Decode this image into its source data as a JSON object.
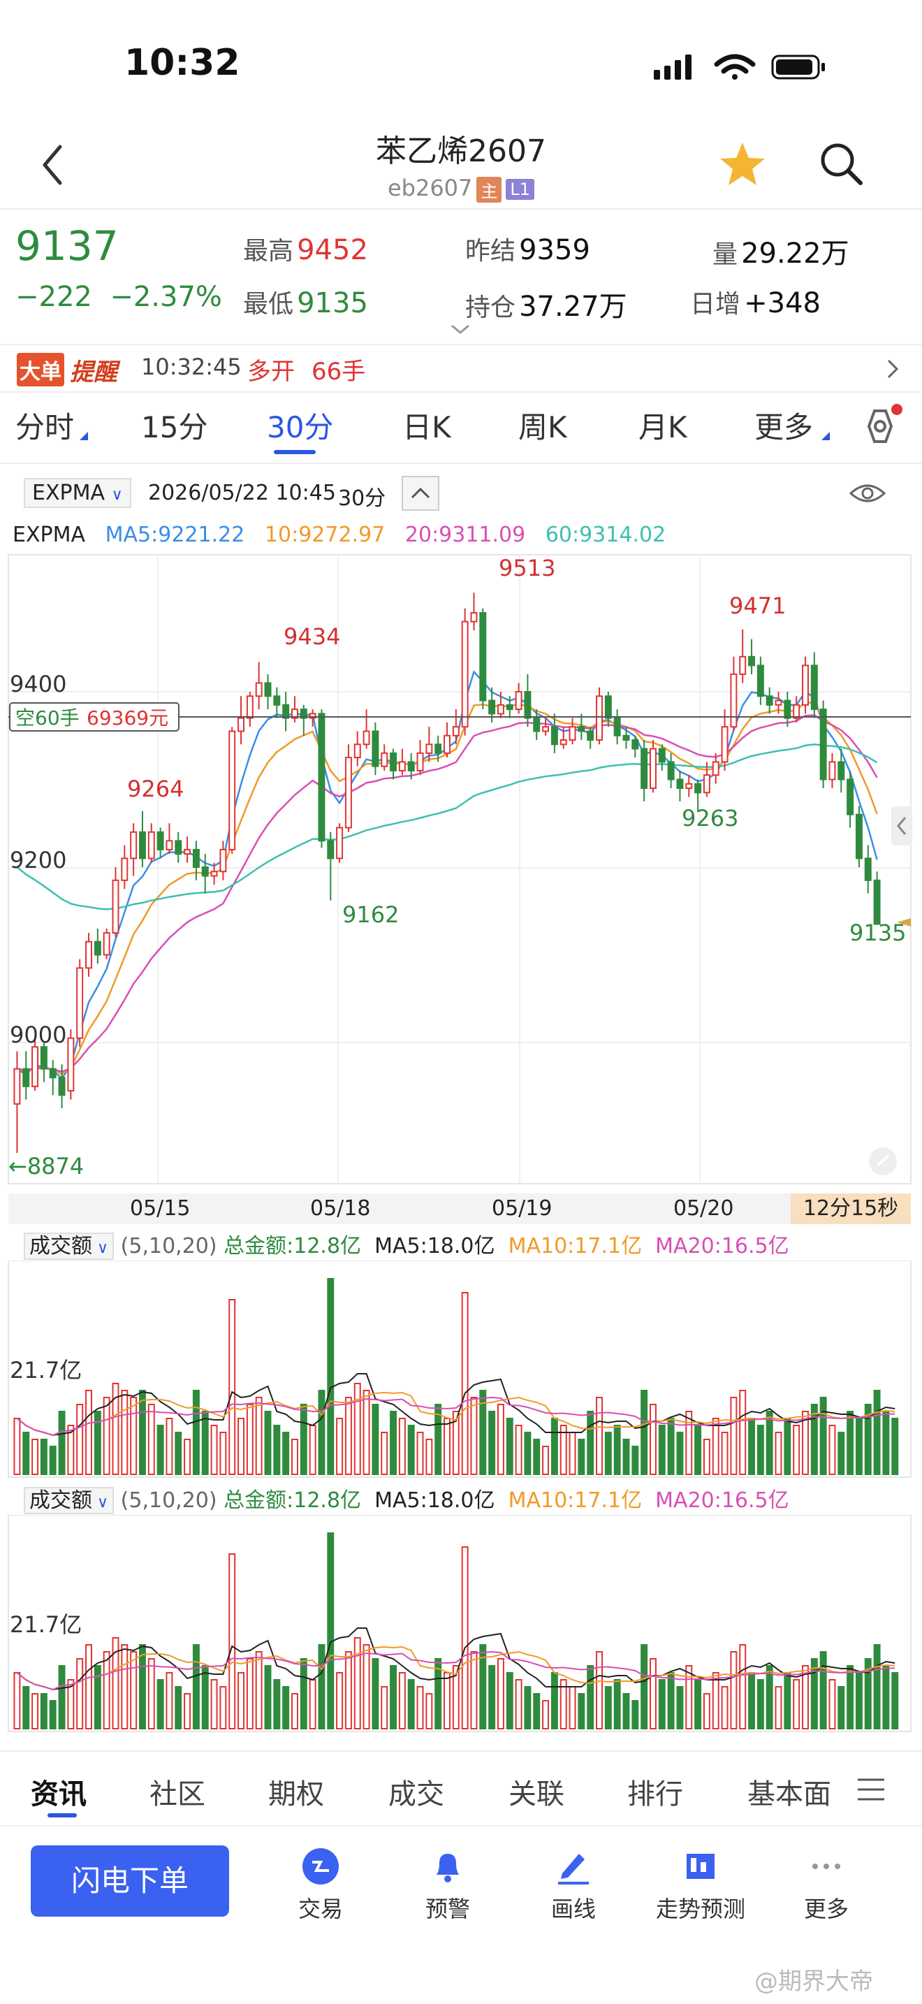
{
  "status": {
    "time": "10:32"
  },
  "header": {
    "title": "苯乙烯2607",
    "code": "eb2607",
    "tag_main": "主",
    "tag_level": "L1"
  },
  "quote": {
    "price": "9137",
    "change": "−222",
    "change_pct": "−2.37%",
    "high_label": "最高",
    "high": "9452",
    "low_label": "最低",
    "low": "9135",
    "prev_settle_label": "昨结",
    "prev_settle": "9359",
    "open_interest_label": "持仓",
    "open_interest": "37.27万",
    "volume_label": "量",
    "volume": "29.22万",
    "daily_increase_label": "日增",
    "daily_increase": "+348"
  },
  "alert": {
    "badge": "大单",
    "word": "提醒",
    "time": "10:32:45",
    "action": "多开",
    "lots": "66手"
  },
  "period_tabs": [
    "分时",
    "15分",
    "30分",
    "日K",
    "周K",
    "月K",
    "更多"
  ],
  "active_period": "30分",
  "chart_toolbar": {
    "indicator": "EXPMA",
    "datetime": "2026/05/22 10:45",
    "period": "30分"
  },
  "ma_legend": {
    "name": "EXPMA",
    "ma5": "MA5:9221.22",
    "ma10": "10:9272.97",
    "ma20": "20:9311.09",
    "ma60": "60:9314.02"
  },
  "price_axis": {
    "top": "9400",
    "mid": "9200",
    "bottom": "9000"
  },
  "position_tag": {
    "text": "空60手",
    "amount": "69369元"
  },
  "price_marks": {
    "high1": "9264",
    "high2": "9434",
    "high3": "9513",
    "high4": "9471",
    "low1": "9162",
    "low2": "9263",
    "low3": "9135",
    "min": "←8874"
  },
  "date_axis": [
    "05/15",
    "05/18",
    "05/19",
    "05/20"
  ],
  "countdown": "12分15秒",
  "volume_panel": {
    "indicator": "成交额",
    "params": "(5,10,20)",
    "total": "总金额:12.8亿",
    "ma5": "MA5:18.0亿",
    "ma10": "MA10:17.1亿",
    "ma20": "MA20:16.5亿",
    "axis_label": "21.7亿"
  },
  "bottom_tabs": [
    "资讯",
    "社区",
    "期权",
    "成交",
    "关联",
    "排行",
    "基本面"
  ],
  "action_button": "闪电下单",
  "nav": [
    "交易",
    "预警",
    "画线",
    "走势预测",
    "更多"
  ],
  "watermark": "@期界大帝",
  "colors": {
    "up": "#e03434",
    "down": "#2e8b3e",
    "accent": "#2a55e5",
    "ma5": "#3a8ee6",
    "ma10": "#f09a28",
    "ma20": "#d84fb3",
    "ma60": "#3dbfb0"
  },
  "chart_data": {
    "type": "candlestick",
    "title": "",
    "period": "30分",
    "ylim": [
      8874,
      9513
    ],
    "candles": [
      [
        8930,
        8970,
        8874,
        8990
      ],
      [
        8970,
        8950,
        8935,
        8990
      ],
      [
        8950,
        8995,
        8945,
        9005
      ],
      [
        8995,
        8970,
        8955,
        9000
      ],
      [
        8970,
        8960,
        8940,
        8980
      ],
      [
        8960,
        8940,
        8925,
        8975
      ],
      [
        8945,
        9005,
        8935,
        9015
      ],
      [
        9005,
        9085,
        8995,
        9095
      ],
      [
        9085,
        9115,
        9075,
        9125
      ],
      [
        9115,
        9100,
        9090,
        9130
      ],
      [
        9100,
        9125,
        9095,
        9130
      ],
      [
        9125,
        9185,
        9120,
        9200
      ],
      [
        9185,
        9210,
        9175,
        9225
      ],
      [
        9210,
        9240,
        9190,
        9250
      ],
      [
        9240,
        9210,
        9200,
        9264
      ],
      [
        9210,
        9240,
        9205,
        9250
      ],
      [
        9240,
        9220,
        9210,
        9245
      ],
      [
        9220,
        9230,
        9215,
        9250
      ],
      [
        9230,
        9215,
        9205,
        9240
      ],
      [
        9215,
        9220,
        9205,
        9235
      ],
      [
        9220,
        9200,
        9185,
        9230
      ],
      [
        9200,
        9190,
        9170,
        9215
      ],
      [
        9190,
        9195,
        9180,
        9205
      ],
      [
        9195,
        9220,
        9185,
        9230
      ],
      [
        9220,
        9355,
        9215,
        9360
      ],
      [
        9355,
        9370,
        9340,
        9395
      ],
      [
        9370,
        9395,
        9360,
        9400
      ],
      [
        9395,
        9410,
        9380,
        9434
      ],
      [
        9410,
        9395,
        9380,
        9420
      ],
      [
        9395,
        9385,
        9370,
        9405
      ],
      [
        9385,
        9370,
        9355,
        9400
      ],
      [
        9370,
        9380,
        9365,
        9395
      ],
      [
        9380,
        9370,
        9350,
        9385
      ],
      [
        9370,
        9375,
        9360,
        9380
      ],
      [
        9375,
        9230,
        9222,
        9380
      ],
      [
        9230,
        9210,
        9162,
        9240
      ],
      [
        9210,
        9245,
        9205,
        9250
      ],
      [
        9245,
        9325,
        9240,
        9340
      ],
      [
        9325,
        9340,
        9315,
        9355
      ],
      [
        9340,
        9355,
        9335,
        9380
      ],
      [
        9355,
        9315,
        9305,
        9365
      ],
      [
        9315,
        9330,
        9310,
        9340
      ],
      [
        9330,
        9310,
        9300,
        9335
      ],
      [
        9310,
        9320,
        9305,
        9335
      ],
      [
        9320,
        9310,
        9300,
        9330
      ],
      [
        9310,
        9330,
        9305,
        9345
      ],
      [
        9330,
        9340,
        9320,
        9360
      ],
      [
        9340,
        9330,
        9320,
        9350
      ],
      [
        9330,
        9350,
        9325,
        9365
      ],
      [
        9350,
        9360,
        9340,
        9380
      ],
      [
        9360,
        9480,
        9350,
        9495
      ],
      [
        9480,
        9490,
        9470,
        9513
      ],
      [
        9490,
        9390,
        9380,
        9495
      ],
      [
        9390,
        9375,
        9365,
        9405
      ],
      [
        9375,
        9385,
        9370,
        9400
      ],
      [
        9385,
        9380,
        9370,
        9395
      ],
      [
        9380,
        9400,
        9375,
        9410
      ],
      [
        9400,
        9370,
        9360,
        9420
      ],
      [
        9370,
        9355,
        9345,
        9380
      ],
      [
        9355,
        9360,
        9350,
        9370
      ],
      [
        9360,
        9340,
        9330,
        9375
      ],
      [
        9340,
        9345,
        9335,
        9360
      ],
      [
        9345,
        9360,
        9340,
        9370
      ],
      [
        9360,
        9355,
        9345,
        9375
      ],
      [
        9355,
        9345,
        9335,
        9360
      ],
      [
        9345,
        9395,
        9340,
        9405
      ],
      [
        9395,
        9370,
        9360,
        9400
      ],
      [
        9370,
        9350,
        9340,
        9380
      ],
      [
        9350,
        9345,
        9335,
        9360
      ],
      [
        9345,
        9335,
        9325,
        9350
      ],
      [
        9335,
        9290,
        9275,
        9345
      ],
      [
        9290,
        9335,
        9285,
        9345
      ],
      [
        9335,
        9320,
        9310,
        9340
      ],
      [
        9320,
        9300,
        9290,
        9330
      ],
      [
        9300,
        9290,
        9275,
        9310
      ],
      [
        9290,
        9295,
        9280,
        9305
      ],
      [
        9295,
        9285,
        9263,
        9300
      ],
      [
        9285,
        9305,
        9280,
        9320
      ],
      [
        9305,
        9320,
        9295,
        9330
      ],
      [
        9320,
        9360,
        9310,
        9380
      ],
      [
        9360,
        9420,
        9355,
        9440
      ],
      [
        9420,
        9440,
        9410,
        9471
      ],
      [
        9440,
        9430,
        9420,
        9460
      ],
      [
        9430,
        9395,
        9385,
        9440
      ],
      [
        9395,
        9385,
        9375,
        9405
      ],
      [
        9385,
        9390,
        9375,
        9400
      ],
      [
        9390,
        9370,
        9360,
        9400
      ],
      [
        9370,
        9385,
        9365,
        9395
      ],
      [
        9385,
        9430,
        9375,
        9440
      ],
      [
        9430,
        9380,
        9370,
        9445
      ],
      [
        9380,
        9300,
        9290,
        9390
      ],
      [
        9300,
        9320,
        9290,
        9330
      ],
      [
        9320,
        9300,
        9285,
        9335
      ],
      [
        9300,
        9260,
        9245,
        9310
      ],
      [
        9260,
        9210,
        9200,
        9270
      ],
      [
        9210,
        9185,
        9170,
        9225
      ],
      [
        9185,
        9135,
        9135,
        9195
      ]
    ],
    "volume_values": [
      8,
      6,
      5,
      5,
      4,
      9,
      7,
      10,
      12,
      9,
      11,
      13,
      12,
      11,
      12,
      10,
      7,
      8,
      6,
      5,
      12,
      9,
      7,
      6,
      25,
      8,
      10,
      11,
      9,
      7,
      6,
      5,
      10,
      7,
      12,
      28,
      8,
      11,
      13,
      12,
      10,
      6,
      9,
      8,
      7,
      6,
      5,
      10,
      8,
      9,
      26,
      11,
      12,
      9,
      10,
      8,
      7,
      6,
      5,
      4,
      8,
      7,
      6,
      5,
      9,
      11,
      6,
      7,
      5,
      4,
      12,
      10,
      7,
      8,
      6,
      9,
      7,
      5,
      8,
      6,
      11,
      12,
      8,
      7,
      9,
      6,
      8,
      7,
      9,
      10,
      11,
      7,
      6,
      9,
      8,
      10,
      12,
      9,
      8
    ],
    "volume_ylim": [
      0,
      30
    ]
  }
}
